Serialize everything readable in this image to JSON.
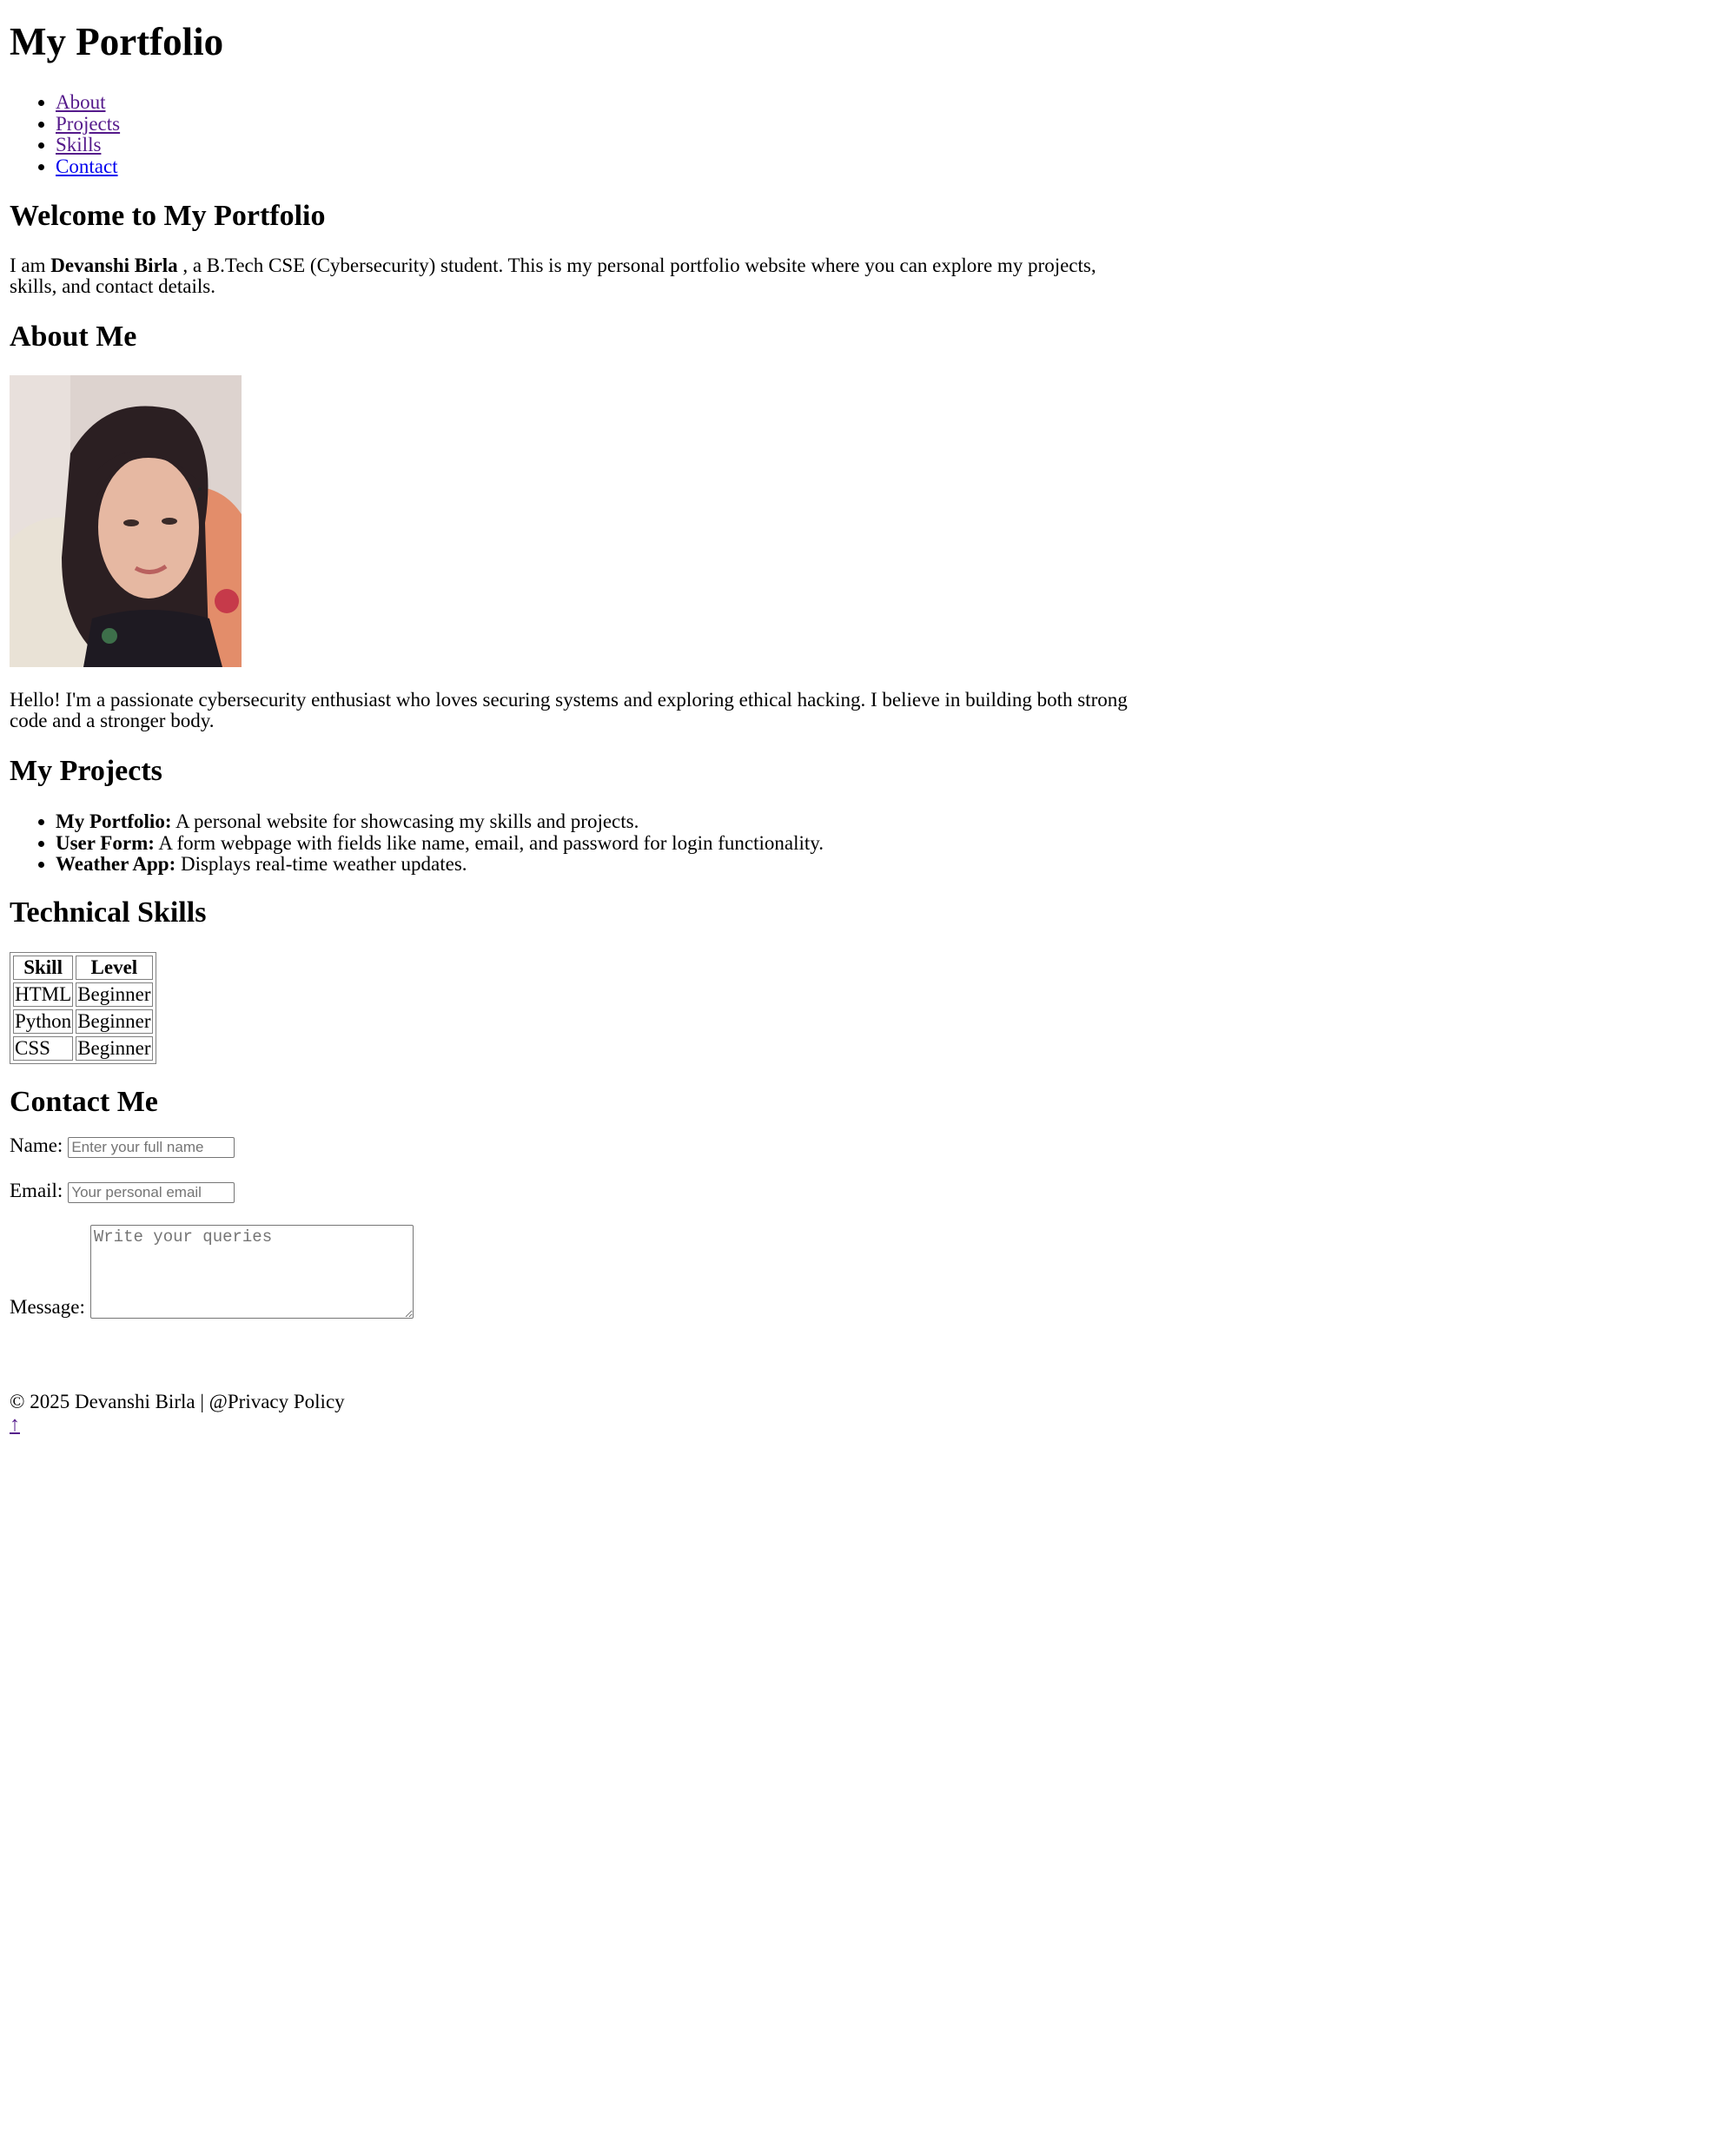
{
  "site": {
    "title": "My Portfolio"
  },
  "nav": {
    "items": [
      "About",
      "Projects",
      "Skills",
      "Contact"
    ]
  },
  "welcome": {
    "heading": "Welcome to My Portfolio",
    "prefix": "I am ",
    "name": "Devanshi Birla ",
    "suffix": ", a B.Tech CSE (Cybersecurity) student. This is my personal portfolio website where you can explore my projects, skills, and contact details."
  },
  "about": {
    "heading": "About Me",
    "photo_icon": "profile-photo",
    "text": "Hello! I'm a passionate cybersecurity enthusiast who loves securing systems and exploring ethical hacking. I believe in building both strong code and a stronger body."
  },
  "projects": {
    "heading": "My Projects",
    "items": [
      {
        "title": "My Portfolio:",
        "desc": " A personal website for showcasing my skills and projects."
      },
      {
        "title": "User Form:",
        "desc": " A form webpage with fields like name, email, and password for login functionality."
      },
      {
        "title": "Weather App:",
        "desc": " Displays real-time weather updates."
      }
    ]
  },
  "skills": {
    "heading": "Technical Skills",
    "columns": [
      "Skill",
      "Level"
    ],
    "rows": [
      [
        "HTML",
        "Beginner"
      ],
      [
        "Python",
        "Beginner"
      ],
      [
        "CSS",
        "Beginner"
      ]
    ]
  },
  "contact": {
    "heading": "Contact Me",
    "name_label": "Name:",
    "name_placeholder": "Enter your full name",
    "email_label": "Email:",
    "email_placeholder": "Your personal email",
    "message_label": "Message:",
    "message_placeholder": "Write your queries"
  },
  "footer": {
    "text": "© 2025 Devanshi Birla | @Privacy Policy"
  },
  "back_to_top": {
    "label": "↑",
    "icon": "arrow-up-icon"
  }
}
